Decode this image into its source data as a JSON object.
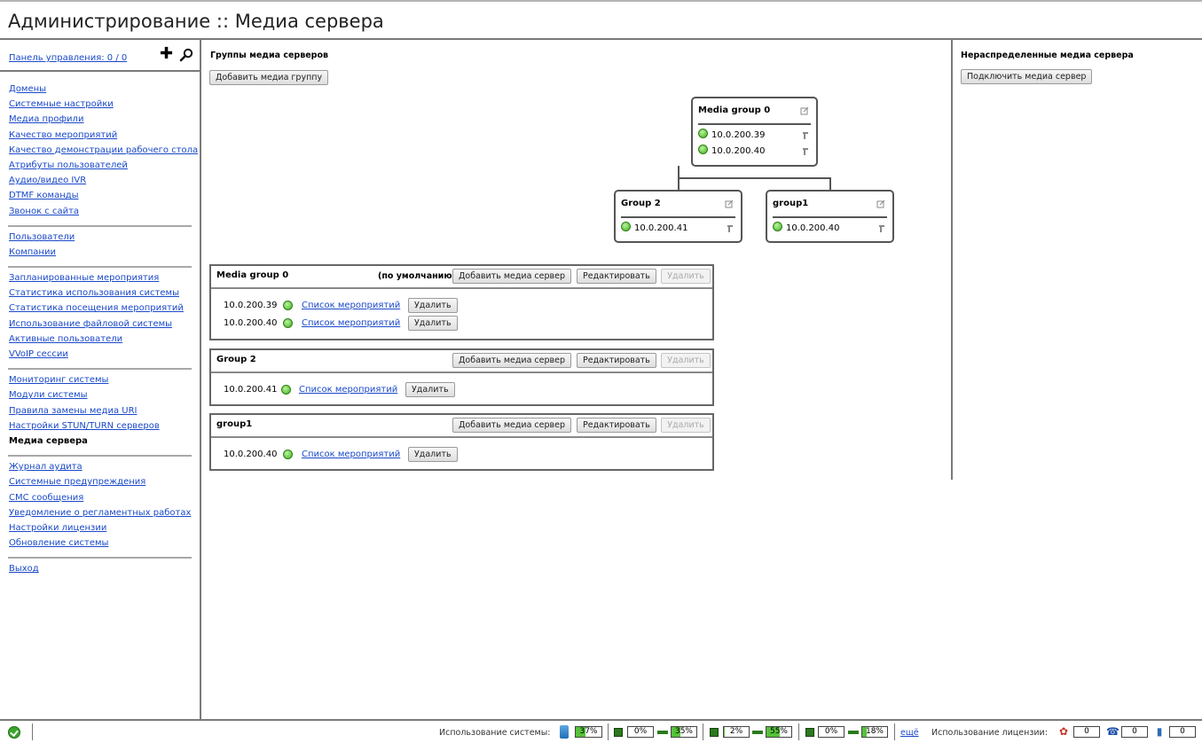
{
  "header": {
    "title": "Администрирование :: Медиа сервера"
  },
  "sidebar": {
    "dashboard_link": "Панель управления: 0 / 0",
    "groups": [
      [
        "Домены",
        "Системные настройки",
        "Медиа профили",
        "Качество мероприятий",
        "Качество демонстрации рабочего стола",
        "Атрибуты пользователей",
        "Аудио/видео IVR",
        "DTMF команды",
        "Звонок с сайта"
      ],
      [
        "Пользователи",
        "Компании"
      ],
      [
        "Запланированные мероприятия",
        "Статистика использования системы",
        "Статистика посещения мероприятий",
        "Использование файловой системы",
        "Активные пользователи",
        "VVoIP сессии"
      ],
      [
        "Мониторинг системы",
        "Модули системы",
        "Правила замены медиа URI",
        "Настройки STUN/TURN серверов",
        "Медиа сервера"
      ],
      [
        "Журнал аудита",
        "Системные предупреждения",
        "СМС сообщения",
        "Уведомление о регламентных работах",
        "Настройки лицензии",
        "Обновление системы"
      ],
      [
        "Выход"
      ]
    ],
    "active_item": "Медиа сервера"
  },
  "main": {
    "section_title": "Группы медиа серверов",
    "add_group_label": "Добавить медиа группу",
    "tree": {
      "root": {
        "name": "Media group 0",
        "servers": [
          "10.0.200.39",
          "10.0.200.40"
        ]
      },
      "children": [
        {
          "name": "Group 2",
          "servers": [
            "10.0.200.41"
          ]
        },
        {
          "name": "group1",
          "servers": [
            "10.0.200.40"
          ]
        }
      ]
    },
    "panels": [
      {
        "name": "Media group 0",
        "default_note": "(по умолчанию)",
        "servers": [
          {
            "ip": "10.0.200.39",
            "events_link": "Список мероприятий",
            "delete_label": "Удалить"
          },
          {
            "ip": "10.0.200.40",
            "events_link": "Список мероприятий",
            "delete_label": "Удалить"
          }
        ]
      },
      {
        "name": "Group 2",
        "default_note": "",
        "servers": [
          {
            "ip": "10.0.200.41",
            "events_link": "Список мероприятий",
            "delete_label": "Удалить"
          }
        ]
      },
      {
        "name": "group1",
        "default_note": "",
        "servers": [
          {
            "ip": "10.0.200.40",
            "events_link": "Список мероприятий",
            "delete_label": "Удалить"
          }
        ]
      }
    ],
    "panel_buttons": {
      "add_server": "Добавить медиа сервер",
      "edit": "Редактировать",
      "delete": "Удалить"
    }
  },
  "right": {
    "section_title": "Нераспределенные медиа сервера",
    "connect_label": "Подключить медиа сервер"
  },
  "footer": {
    "system_usage_label": "Использование системы:",
    "meters": [
      {
        "value": "37%",
        "fraction": 0.37
      },
      {
        "value": "0%",
        "fraction": 0.0
      },
      {
        "value": "35%",
        "fraction": 0.35
      },
      {
        "value": "2%",
        "fraction": 0.02
      },
      {
        "value": "55%",
        "fraction": 0.55
      },
      {
        "value": "0%",
        "fraction": 0.0
      },
      {
        "value": "18%",
        "fraction": 0.18
      }
    ],
    "more_link": "ещё",
    "license_usage_label": "Использование лицензии:",
    "licenses": [
      "0",
      "0",
      "0"
    ],
    "colors": {
      "meter_fill": "#55c23a",
      "ok": "#3aa52b",
      "link": "#1a49c9"
    }
  }
}
